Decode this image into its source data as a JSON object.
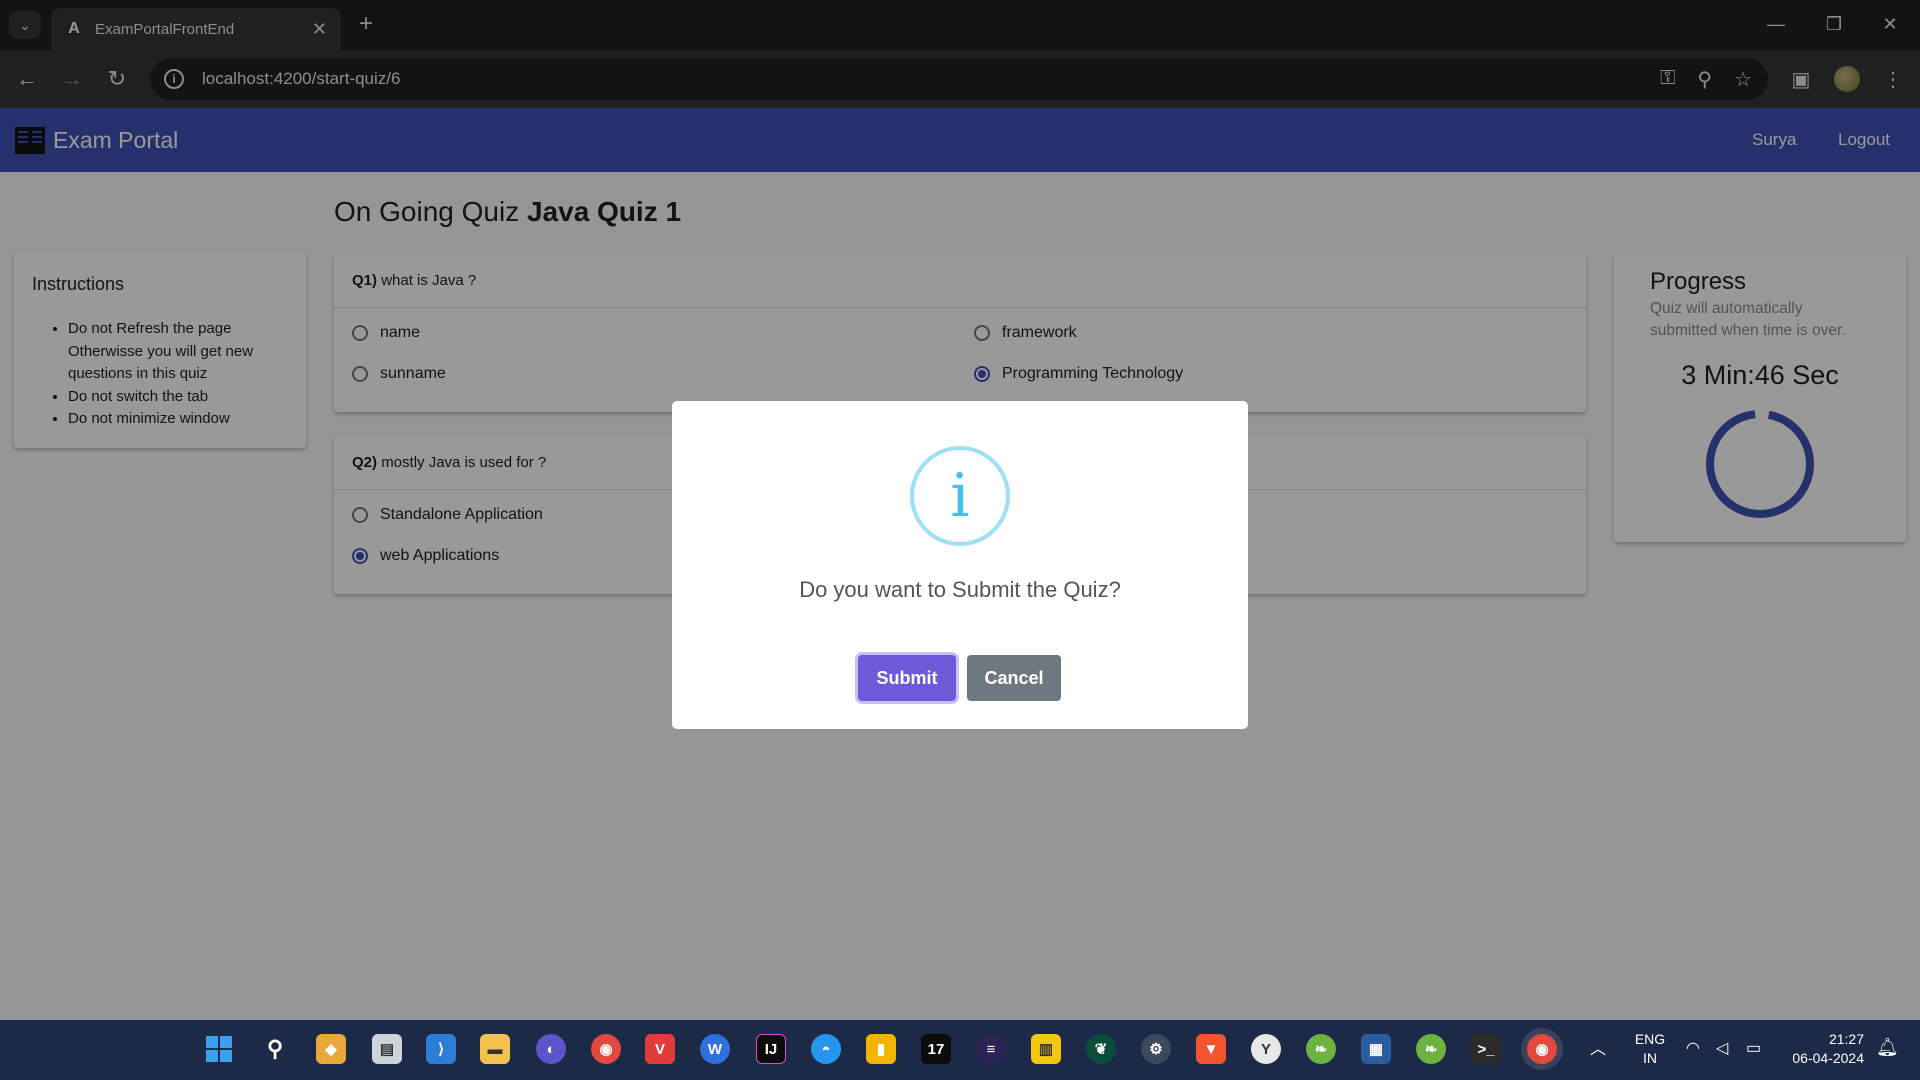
{
  "browser": {
    "tab_title": "ExamPortalFrontEnd",
    "url": "localhost:4200/start-quiz/6",
    "tab_favicon": "angular-icon"
  },
  "navbar": {
    "brand": "Exam Portal",
    "user": "Surya",
    "logout": "Logout",
    "color": "#3f51b5"
  },
  "page": {
    "heading_prefix": "On Going Quiz",
    "quiz_title": "Java Quiz 1"
  },
  "instructions": {
    "title": "Instructions",
    "items": [
      "Do not Refresh the page Otherwisse you will get new questions in this quiz",
      "Do not switch the tab",
      "Do not minimize window"
    ]
  },
  "questions": [
    {
      "number": "Q1)",
      "text": "what is Java ?",
      "options": [
        {
          "label": "name",
          "selected": false
        },
        {
          "label": "framework",
          "selected": false
        },
        {
          "label": "sunname",
          "selected": false
        },
        {
          "label": "Programming Technology",
          "selected": true
        }
      ]
    },
    {
      "number": "Q2)",
      "text": "mostly Java is used for ?",
      "options": [
        {
          "label": "Standalone Application",
          "selected": false
        },
        {
          "label": "web Applications",
          "selected": true
        }
      ]
    }
  ],
  "progress": {
    "title": "Progress",
    "subtitle": "Quiz will automatically submitted when time is over.",
    "timer": "3 Min:46 Sec"
  },
  "modal": {
    "icon": "info-icon",
    "icon_glyph": "i",
    "title": "Do you want to Submit the Quiz?",
    "submit": "Submit",
    "cancel": "Cancel",
    "submit_color": "#6e5ad8",
    "cancel_color": "#6e7881"
  },
  "taskbar": {
    "lang_top": "ENG",
    "lang_bottom": "IN",
    "time": "21:27",
    "date": "06-04-2024"
  }
}
